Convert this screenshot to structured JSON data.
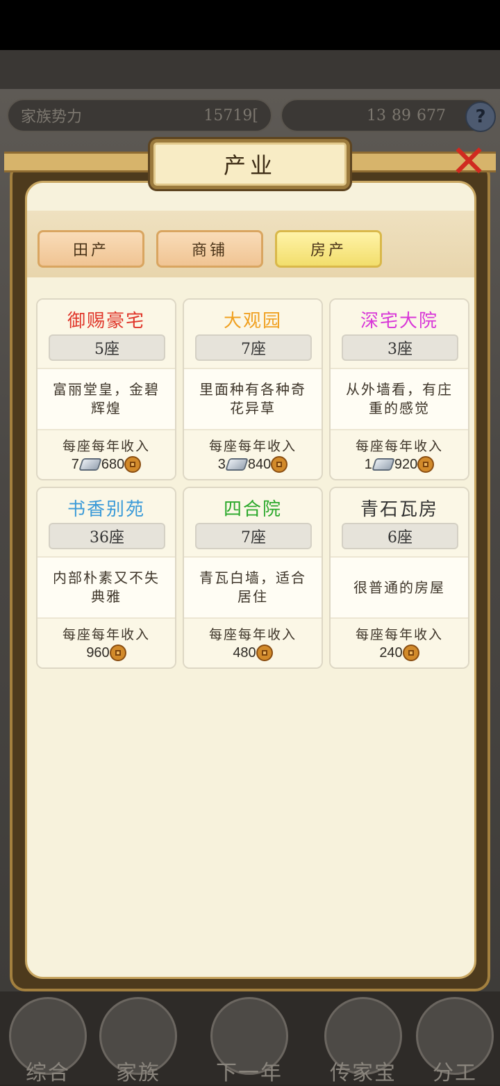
{
  "hud": {
    "left_label": "家族势力",
    "left_value": "15719[",
    "left_value_end": "]",
    "gold": "13",
    "silver": "89",
    "copper": "677",
    "help": "?"
  },
  "modal": {
    "title": "产业",
    "close": "✕"
  },
  "tabs": [
    {
      "label": "田产",
      "active": false
    },
    {
      "label": "商铺",
      "active": false
    },
    {
      "label": "房产",
      "active": true
    }
  ],
  "properties": [
    {
      "name": "御赐豪宅",
      "color": "#e0362a",
      "count": "5座",
      "desc": "富丽堂皇，金碧辉煌",
      "income_label": "每座每年收入",
      "silver": "7",
      "copper": "680"
    },
    {
      "name": "大观园",
      "color": "#f0a020",
      "count": "7座",
      "desc": "里面种有各种奇花异草",
      "income_label": "每座每年收入",
      "silver": "3",
      "copper": "840"
    },
    {
      "name": "深宅大院",
      "color": "#d836d8",
      "count": "3座",
      "desc": "从外墙看，有庄重的感觉",
      "income_label": "每座每年收入",
      "silver": "1",
      "copper": "920"
    },
    {
      "name": "书香别苑",
      "color": "#3a9ad8",
      "count": "36座",
      "desc": "内部朴素又不失典雅",
      "income_label": "每座每年收入",
      "silver": "",
      "copper": "960"
    },
    {
      "name": "四合院",
      "color": "#2aa82a",
      "count": "7座",
      "desc": "青瓦白墙，适合居住",
      "income_label": "每座每年收入",
      "silver": "",
      "copper": "480"
    },
    {
      "name": "青石瓦房",
      "color": "#333333",
      "count": "6座",
      "desc": "很普通的房屋",
      "income_label": "每座每年收入",
      "silver": "",
      "copper": "240"
    }
  ],
  "bottom_nav": [
    {
      "label": "综合"
    },
    {
      "label": "家族"
    },
    {
      "label": "下一年"
    },
    {
      "label": "传家宝"
    },
    {
      "label": "分工"
    }
  ]
}
